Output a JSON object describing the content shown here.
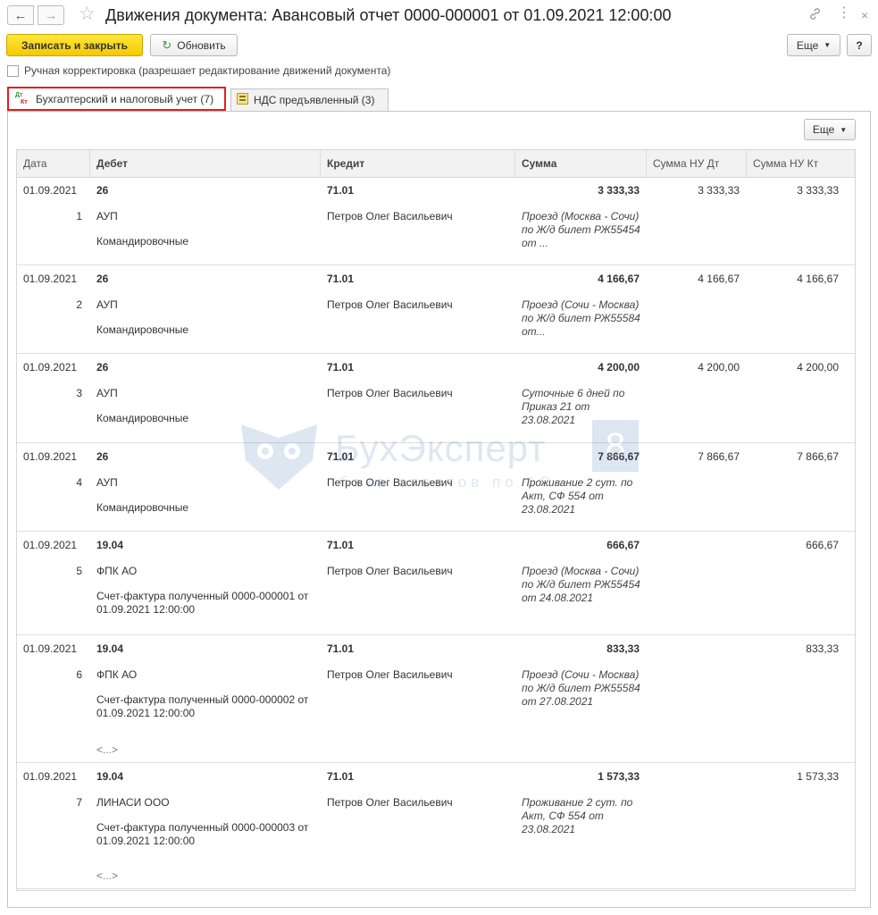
{
  "window": {
    "title": "Движения документа: Авансовый отчет 0000-000001 от 01.09.2021 12:00:00"
  },
  "toolbar": {
    "save_close_label": "Записать и закрыть",
    "refresh_label": "Обновить",
    "more_label": "Еще",
    "help_label": "?"
  },
  "manual_correction": {
    "label": "Ручная корректировка (разрешает редактирование движений документа)"
  },
  "tabs": [
    {
      "label": "Бухгалтерский и налоговый учет (7)",
      "icon_text": "Дт Кт"
    },
    {
      "label": "НДС предъявленный (3)"
    }
  ],
  "panel": {
    "more_label": "Еще"
  },
  "grid": {
    "columns": [
      "Дата",
      "Дебет",
      "Кредит",
      "Сумма",
      "Сумма НУ Дт",
      "Сумма НУ Кт"
    ],
    "rows": [
      {
        "date": "01.09.2021",
        "num": "1",
        "debit": "26",
        "debit_sub1": "АУП",
        "debit_sub2": "Командировочные",
        "credit": "71.01",
        "credit_sub": "Петров Олег Васильевич",
        "sum": "3 333,33",
        "content": "Проезд (Москва - Сочи) по Ж/д билет РЖ55454 от ...",
        "nu_dt": "3 333,33",
        "nu_kt": "3 333,33",
        "more": ""
      },
      {
        "date": "01.09.2021",
        "num": "2",
        "debit": "26",
        "debit_sub1": "АУП",
        "debit_sub2": "Командировочные",
        "credit": "71.01",
        "credit_sub": "Петров Олег Васильевич",
        "sum": "4 166,67",
        "content": "Проезд (Сочи - Москва) по Ж/д билет РЖ55584 от...",
        "nu_dt": "4 166,67",
        "nu_kt": "4 166,67",
        "more": ""
      },
      {
        "date": "01.09.2021",
        "num": "3",
        "debit": "26",
        "debit_sub1": "АУП",
        "debit_sub2": "Командировочные",
        "credit": "71.01",
        "credit_sub": "Петров Олег Васильевич",
        "sum": "4 200,00",
        "content": "Суточные 6 дней по Приказ 21 от 23.08.2021",
        "nu_dt": "4 200,00",
        "nu_kt": "4 200,00",
        "more": ""
      },
      {
        "date": "01.09.2021",
        "num": "4",
        "debit": "26",
        "debit_sub1": "АУП",
        "debit_sub2": "Командировочные",
        "credit": "71.01",
        "credit_sub": "Петров Олег Васильевич",
        "sum": "7 866,67",
        "content": "Проживание 2 сут. по Акт, СФ 554 от 23.08.2021",
        "nu_dt": "7 866,67",
        "nu_kt": "7 866,67",
        "more": ""
      },
      {
        "date": "01.09.2021",
        "num": "5",
        "debit": "19.04",
        "debit_sub1": "ФПК АО",
        "debit_sub2": "Счет-фактура полученный 0000-000001 от 01.09.2021 12:00:00",
        "credit": "71.01",
        "credit_sub": "Петров Олег Васильевич",
        "sum": "666,67",
        "content": "Проезд (Москва - Сочи) по Ж/д билет РЖ55454 от 24.08.2021",
        "nu_dt": "",
        "nu_kt": "666,67",
        "more": ""
      },
      {
        "date": "01.09.2021",
        "num": "6",
        "debit": "19.04",
        "debit_sub1": "ФПК АО",
        "debit_sub2": "Счет-фактура полученный 0000-000002 от 01.09.2021 12:00:00",
        "credit": "71.01",
        "credit_sub": "Петров Олег Васильевич",
        "sum": "833,33",
        "content": "Проезд (Сочи - Москва) по Ж/д билет РЖ55584 от 27.08.2021",
        "nu_dt": "",
        "nu_kt": "833,33",
        "more": "<...>"
      },
      {
        "date": "01.09.2021",
        "num": "7",
        "debit": "19.04",
        "debit_sub1": "ЛИНАСИ ООО",
        "debit_sub2": "Счет-фактура полученный 0000-000003 от 01.09.2021 12:00:00",
        "credit": "71.01",
        "credit_sub": "Петров Олег Васильевич",
        "sum": "1 573,33",
        "content": "Проживание 2 сут. по Акт, СФ 554 от 23.08.2021",
        "nu_dt": "",
        "nu_kt": "1 573,33",
        "more": "<...>"
      }
    ]
  },
  "watermark": {
    "name": "БухЭксперт",
    "digit": "8",
    "tagline": "база ответов по 1С"
  }
}
